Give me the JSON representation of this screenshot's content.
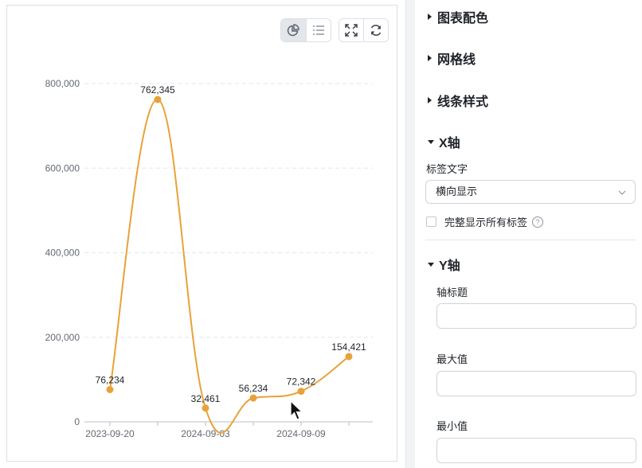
{
  "chart_data": {
    "type": "line",
    "categories": [
      "2023-09-20",
      "",
      "2024-09-03",
      "",
      "2024-09-09",
      ""
    ],
    "tick_labels_shown": [
      "2023-09-20",
      "2024-09-03",
      "2024-09-09"
    ],
    "values": [
      76234,
      762345,
      32461,
      56234,
      72342,
      154421
    ],
    "data_labels": [
      "76,234",
      "762,345",
      "32,461",
      "56,234",
      "72,342",
      "154,421"
    ],
    "y_ticks": [
      "0",
      "200,000",
      "400,000",
      "600,000",
      "800,000"
    ],
    "ylim": [
      0,
      800000
    ],
    "grid": "horizontal-dashed",
    "color": "#e8a23a"
  },
  "toolbar": {
    "chart_icon": "pie-chart-icon",
    "list_icon": "list-icon",
    "fullscreen_icon": "fullscreen-icon",
    "refresh_icon": "refresh-icon"
  },
  "settings": {
    "sections": {
      "chart_colors": "图表配色",
      "grid_lines": "网格线",
      "line_style": "线条样式",
      "x_axis": "X轴",
      "y_axis": "Y轴"
    },
    "x_axis": {
      "label_text_title": "标签文字",
      "label_direction_value": "横向显示",
      "show_all_labels": "完整显示所有标签",
      "help_symbol": "?"
    },
    "y_axis": {
      "axis_title_label": "轴标题",
      "axis_title_value": "",
      "max_label": "最大值",
      "max_value": "",
      "min_label": "最小值",
      "min_value": ""
    }
  }
}
